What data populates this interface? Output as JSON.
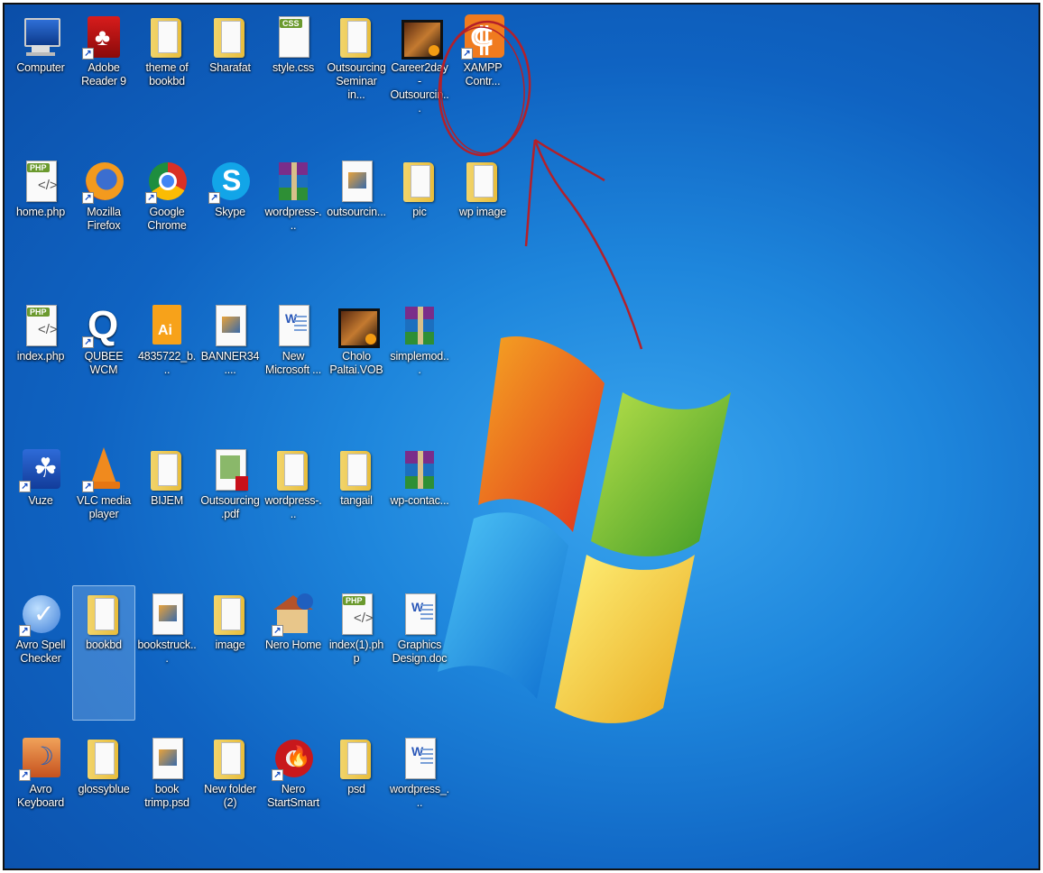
{
  "desktop": {
    "colors": {
      "wallpaper": "#1e86dc",
      "annotation": "#b3202a"
    },
    "icons": [
      {
        "label": "Computer",
        "icon": "computer-icon",
        "shortcut": false
      },
      {
        "label": "Adobe Reader 9",
        "icon": "adobe-reader-icon",
        "shortcut": true
      },
      {
        "label": "theme of bookbd",
        "icon": "folder-icon",
        "shortcut": false
      },
      {
        "label": "Sharafat",
        "icon": "folder-icon",
        "shortcut": false
      },
      {
        "label": "style.css",
        "icon": "css-file-icon",
        "shortcut": false
      },
      {
        "label": "Outsourcing Seminar in...",
        "icon": "folder-icon",
        "shortcut": false
      },
      {
        "label": "Career2day - Outsourcin...",
        "icon": "video-file-icon",
        "shortcut": false
      },
      {
        "label": "XAMPP Contr...",
        "icon": "xampp-icon",
        "shortcut": true
      },
      {
        "label": "home.php",
        "icon": "php-file-icon",
        "shortcut": false
      },
      {
        "label": "Mozilla Firefox",
        "icon": "firefox-icon",
        "shortcut": true
      },
      {
        "label": "Google Chrome",
        "icon": "chrome-icon",
        "shortcut": true
      },
      {
        "label": "Skype",
        "icon": "skype-icon",
        "shortcut": true
      },
      {
        "label": "wordpress-...",
        "icon": "rar-archive-icon",
        "shortcut": false
      },
      {
        "label": "outsourcin...",
        "icon": "image-file-icon",
        "shortcut": false
      },
      {
        "label": "pic",
        "icon": "folder-icon",
        "shortcut": false
      },
      {
        "label": "wp image",
        "icon": "folder-icon",
        "shortcut": false
      },
      {
        "label": "index.php",
        "icon": "php-file-icon",
        "shortcut": false
      },
      {
        "label": "QUBEE WCM",
        "icon": "qubee-icon",
        "shortcut": true
      },
      {
        "label": "4835722_b...",
        "icon": "illustrator-file-icon",
        "shortcut": false
      },
      {
        "label": "BANNER34....",
        "icon": "image-file-icon",
        "shortcut": false
      },
      {
        "label": "New Microsoft ...",
        "icon": "word-doc-icon",
        "shortcut": false
      },
      {
        "label": "Cholo Paltai.VOB",
        "icon": "video-file-icon",
        "shortcut": false
      },
      {
        "label": "simplemod...",
        "icon": "rar-archive-icon",
        "shortcut": false
      },
      {
        "label": "Vuze",
        "icon": "vuze-icon",
        "shortcut": true
      },
      {
        "label": "VLC media player",
        "icon": "vlc-icon",
        "shortcut": true
      },
      {
        "label": "BIJEM",
        "icon": "folder-icon",
        "shortcut": false
      },
      {
        "label": "Outsourcing .pdf",
        "icon": "pdf-file-icon",
        "shortcut": false
      },
      {
        "label": "wordpress-...",
        "icon": "folder-icon",
        "shortcut": false
      },
      {
        "label": "tangail",
        "icon": "folder-icon",
        "shortcut": false
      },
      {
        "label": "wp-contac...",
        "icon": "rar-archive-icon",
        "shortcut": false
      },
      {
        "label": "Avro Spell Checker",
        "icon": "avro-spell-icon",
        "shortcut": true
      },
      {
        "label": "bookbd",
        "icon": "folder-icon",
        "shortcut": false,
        "selected": true
      },
      {
        "label": "bookstruck...",
        "icon": "image-file-icon",
        "shortcut": false
      },
      {
        "label": "image",
        "icon": "folder-icon",
        "shortcut": false
      },
      {
        "label": "Nero Home",
        "icon": "nero-home-icon",
        "shortcut": true
      },
      {
        "label": "index(1).php",
        "icon": "php-file-icon",
        "shortcut": false
      },
      {
        "label": "Graphics Design.doc",
        "icon": "word-doc-icon",
        "shortcut": false
      },
      {
        "label": "Avro Keyboard",
        "icon": "avro-keyboard-icon",
        "shortcut": true
      },
      {
        "label": "glossyblue",
        "icon": "folder-icon",
        "shortcut": false
      },
      {
        "label": "book trimp.psd",
        "icon": "image-file-icon",
        "shortcut": false
      },
      {
        "label": "New folder (2)",
        "icon": "folder-icon",
        "shortcut": false
      },
      {
        "label": "Nero StartSmart",
        "icon": "nero-startsmart-icon",
        "shortcut": true
      },
      {
        "label": "psd",
        "icon": "folder-icon",
        "shortcut": false
      },
      {
        "label": "wordpress_...",
        "icon": "word-doc-icon",
        "shortcut": false
      }
    ]
  }
}
